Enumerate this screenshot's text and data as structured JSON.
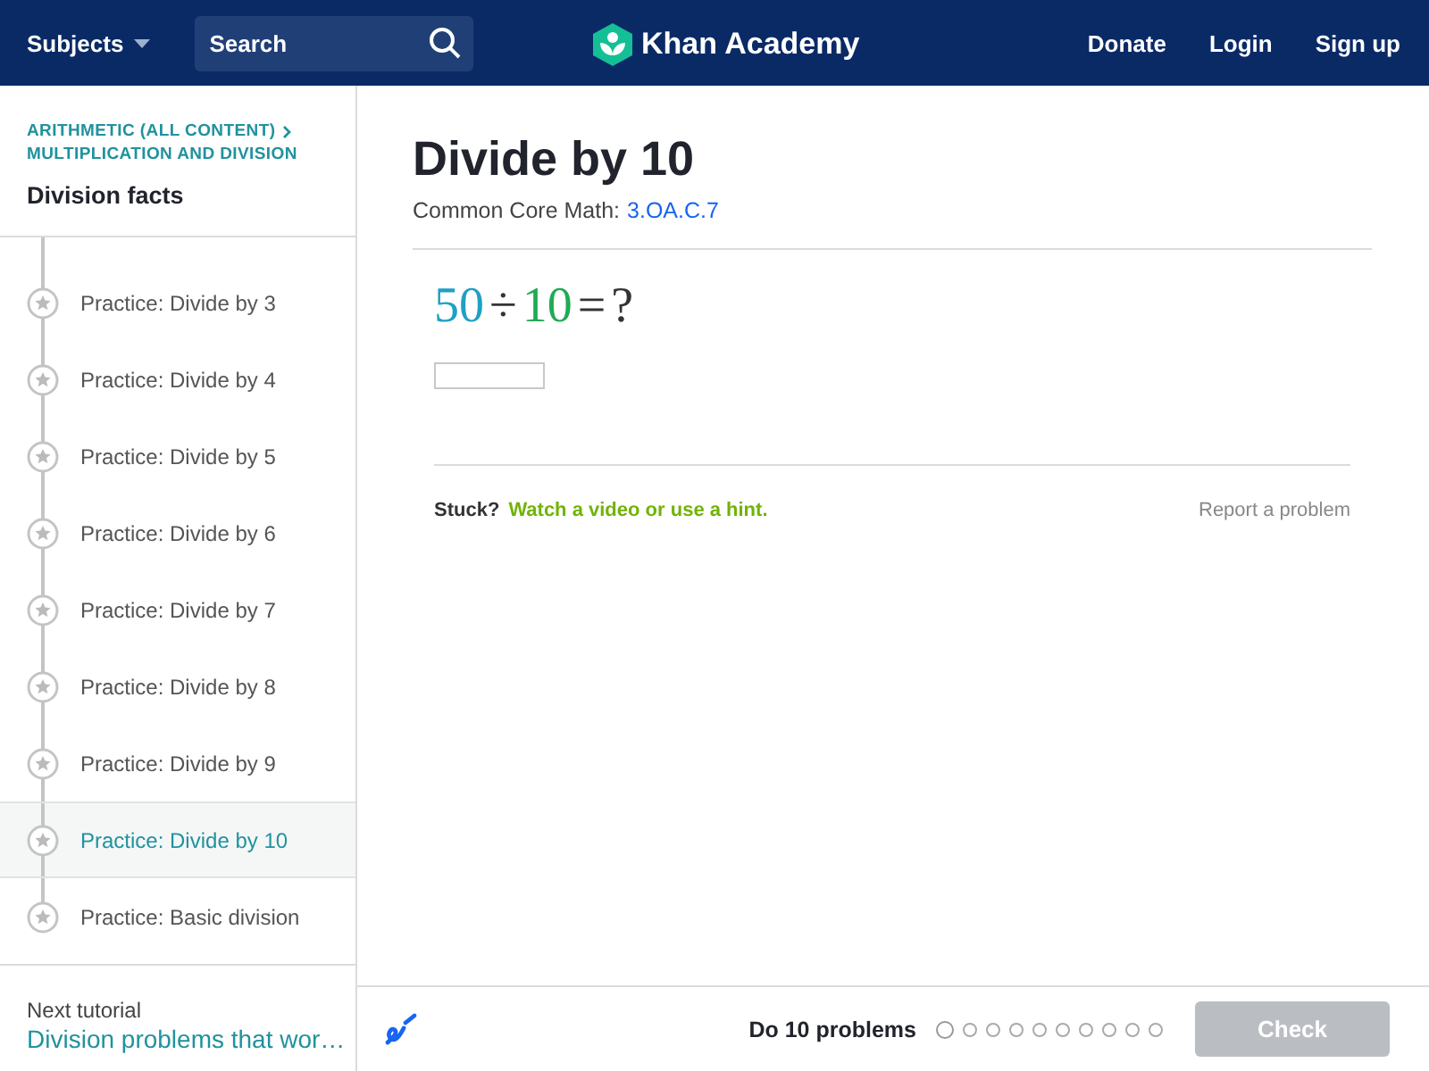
{
  "header": {
    "subjects": "Subjects",
    "search": {
      "placeholder": "Search"
    },
    "logo": "Khan Academy",
    "links": [
      "Donate",
      "Login",
      "Sign up"
    ]
  },
  "sidebar": {
    "breadcrumbs": [
      "ARITHMETIC (ALL CONTENT)",
      "MULTIPLICATION AND DIVISION"
    ],
    "title": "Division facts",
    "items": [
      {
        "label": "Practice: Divide by 3",
        "selected": false
      },
      {
        "label": "Practice: Divide by 4",
        "selected": false
      },
      {
        "label": "Practice: Divide by 5",
        "selected": false
      },
      {
        "label": "Practice: Divide by 6",
        "selected": false
      },
      {
        "label": "Practice: Divide by 7",
        "selected": false
      },
      {
        "label": "Practice: Divide by 8",
        "selected": false
      },
      {
        "label": "Practice: Divide by 9",
        "selected": false
      },
      {
        "label": "Practice: Divide by 10",
        "selected": true
      },
      {
        "label": "Practice: Basic division",
        "selected": false
      }
    ],
    "next": {
      "label": "Next tutorial",
      "link": "Division problems that wor…"
    }
  },
  "exercise": {
    "title": "Divide by 10",
    "standard_label": "Common Core Math:",
    "standard_link": "3.OA.C.7",
    "equation": [
      {
        "text": "50",
        "color": "#1fa0c4"
      },
      {
        "text": "÷",
        "color": "#333333"
      },
      {
        "text": "10",
        "color": "#1fab54"
      },
      {
        "text": "=",
        "color": "#333333"
      },
      {
        "text": "?",
        "color": "#333333"
      }
    ],
    "stuck": "Stuck?",
    "hint_link": "Watch a video or use a hint.",
    "report": "Report a problem"
  },
  "footer": {
    "task": "Do 10 problems",
    "dots": [
      {
        "current": true
      },
      {
        "current": false
      },
      {
        "current": false
      },
      {
        "current": false
      },
      {
        "current": false
      },
      {
        "current": false
      },
      {
        "current": false
      },
      {
        "current": false
      },
      {
        "current": false
      },
      {
        "current": false
      }
    ],
    "check": {
      "label": "Check",
      "disabled": true
    }
  }
}
